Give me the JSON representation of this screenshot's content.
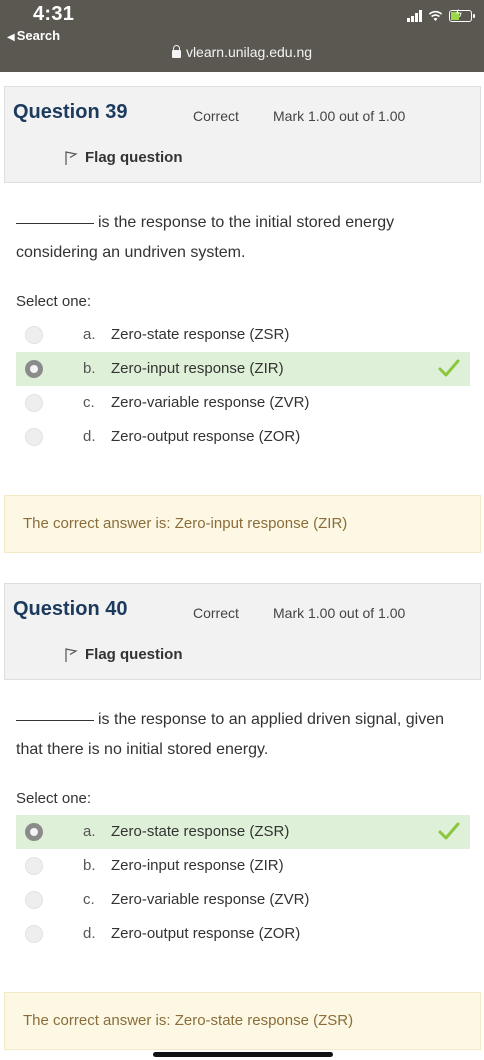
{
  "status_bar": {
    "time": "4:31",
    "back_label": "Search",
    "url": "vlearn.unilag.edu.ng"
  },
  "questions": [
    {
      "title": "Question 39",
      "state": "Correct",
      "grade": "Mark 1.00 out of 1.00",
      "flag_label": "Flag question",
      "text": "is the response to the initial stored energy considering an undriven system.",
      "prompt": "Select one:",
      "options": [
        {
          "letter": "a.",
          "text": "Zero-state response (ZSR)",
          "selected": false
        },
        {
          "letter": "b.",
          "text": "Zero-input response (ZIR)",
          "selected": true
        },
        {
          "letter": "c.",
          "text": "Zero-variable response (ZVR)",
          "selected": false
        },
        {
          "letter": "d.",
          "text": "Zero-output response (ZOR)",
          "selected": false
        }
      ],
      "feedback": "The correct answer is: Zero-input response (ZIR)"
    },
    {
      "title": "Question 40",
      "state": "Correct",
      "grade": "Mark 1.00 out of 1.00",
      "flag_label": "Flag question",
      "text": "is the response to an applied driven signal, given that there is no initial stored energy.",
      "prompt": "Select one:",
      "options": [
        {
          "letter": "a.",
          "text": "Zero-state response (ZSR)",
          "selected": true
        },
        {
          "letter": "b.",
          "text": "Zero-input response (ZIR)",
          "selected": false
        },
        {
          "letter": "c.",
          "text": "Zero-variable response (ZVR)",
          "selected": false
        },
        {
          "letter": "d.",
          "text": "Zero-output response (ZOR)",
          "selected": false
        }
      ],
      "feedback": "The correct answer is: Zero-state response (ZSR)"
    }
  ],
  "colors": {
    "title": "#1c3a5e",
    "correct_bg": "#dff0d8",
    "tick": "#8cc63f",
    "feedback_bg": "#fcf8e3",
    "feedback_text": "#8a6d3b",
    "topbar_bg": "#5b5852"
  },
  "icons": {
    "flag": "flag-icon",
    "tick": "checkmark-icon",
    "lock": "lock-icon"
  }
}
